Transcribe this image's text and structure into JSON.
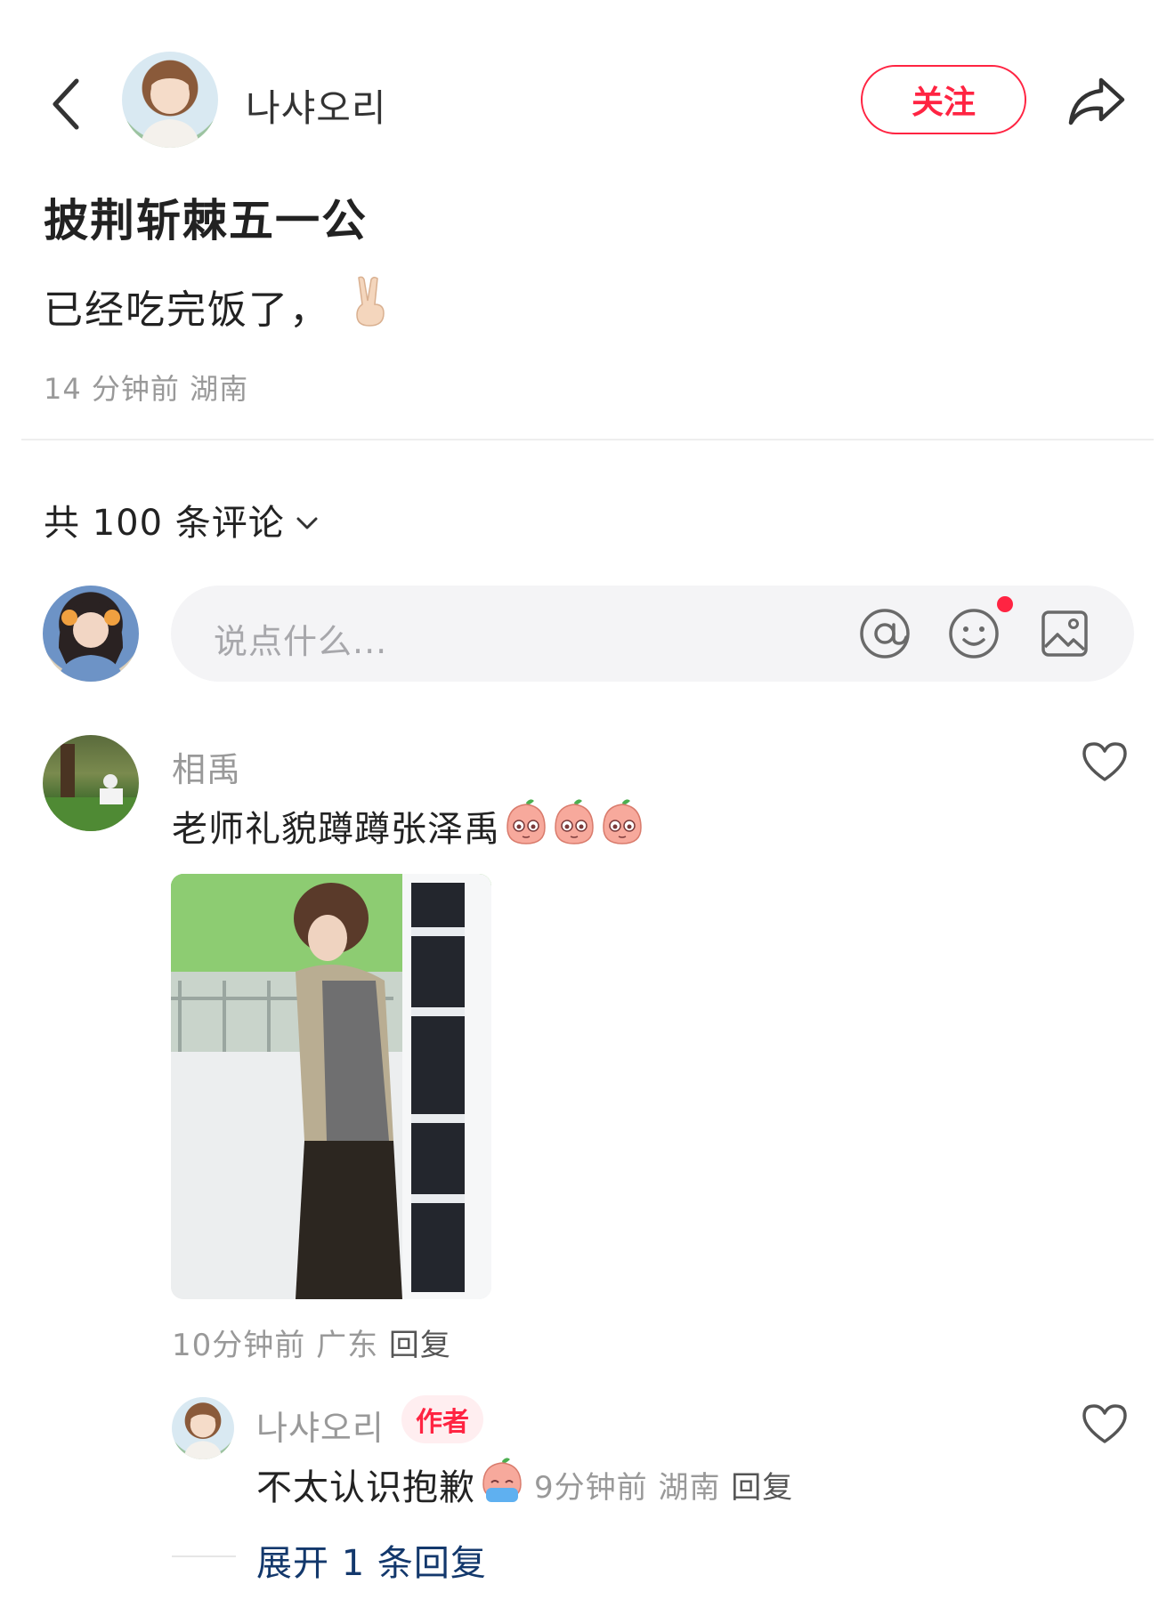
{
  "header": {
    "author_name": "나샤오리",
    "follow_label": "关注"
  },
  "post": {
    "title": "披荆斩棘五一公",
    "body": "已经吃完饭了，",
    "time": "14 分钟前",
    "location": "湖南"
  },
  "comments_header": {
    "label": "共 100 条评论"
  },
  "comment_input": {
    "placeholder": "说点什么..."
  },
  "comments": [
    {
      "user": "相禹",
      "text": "老师礼貌蹲蹲张泽禹",
      "time": "10分钟前",
      "location": "广东",
      "reply_label": "回复",
      "replies": [
        {
          "user": "나샤오리",
          "badge": "作者",
          "text": "不太认识抱歉",
          "time": "9分钟前",
          "location": "湖南",
          "reply_label": "回复"
        }
      ],
      "expand_label": "展开 1 条回复"
    }
  ],
  "colors": {
    "accent": "#ff2442",
    "muted_text": "#999999",
    "link_blue": "#13386c",
    "input_bg": "#f4f4f6"
  }
}
